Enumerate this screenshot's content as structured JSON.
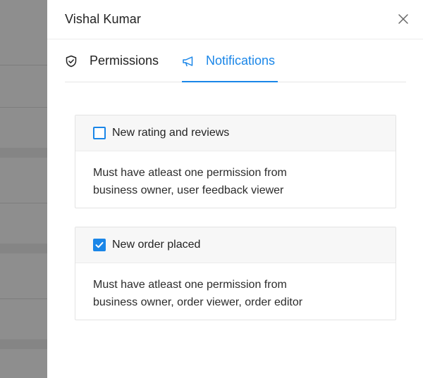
{
  "drawer": {
    "title": "Vishal Kumar",
    "close_icon": "close-icon"
  },
  "tabs": [
    {
      "label": "Permissions",
      "icon": "shield-check-icon",
      "active": false
    },
    {
      "label": "Notifications",
      "icon": "megaphone-icon",
      "active": true
    }
  ],
  "notifications": [
    {
      "label": "New rating and reviews",
      "checked": false,
      "description_lines": [
        "Must have atleast one permission from",
        "business owner, user feedback viewer"
      ]
    },
    {
      "label": "New order placed",
      "checked": true,
      "description_lines": [
        "Must have atleast one permission from",
        "business owner, order viewer, order editor"
      ]
    }
  ],
  "colors": {
    "accent": "#1a86e8",
    "backdrop": "#8f8f8f",
    "card_header": "#f7f7f7"
  }
}
